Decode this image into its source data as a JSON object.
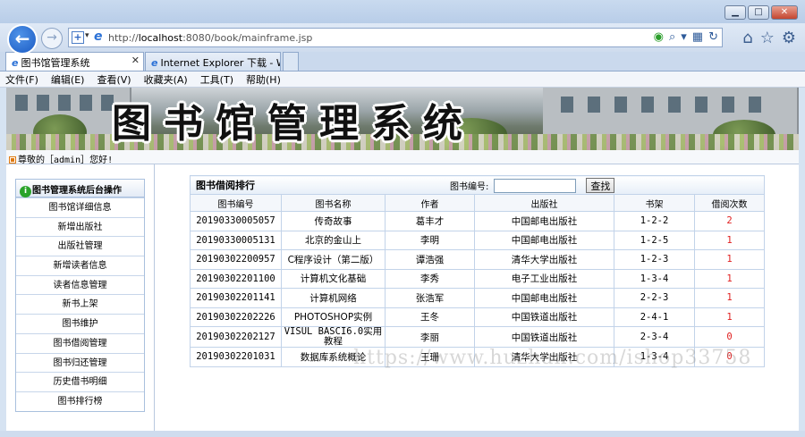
{
  "browser": {
    "url_prefix": "http://",
    "url_host": "localhost",
    "url_rest": ":8080/book/mainframe.jsp",
    "tabs": [
      {
        "label": "图书馆管理系统",
        "active": true
      },
      {
        "label": "Internet Explorer 下载 - W...",
        "active": false
      }
    ],
    "menu": [
      "文件(F)",
      "编辑(E)",
      "查看(V)",
      "收藏夹(A)",
      "工具(T)",
      "帮助(H)"
    ],
    "window_buttons": {
      "minimize": "▁",
      "maximize": "□",
      "close": "✕"
    }
  },
  "banner": {
    "title": "图书馆管理系统"
  },
  "welcome": {
    "text": "尊敬的［admin］您好!"
  },
  "sidebar": {
    "title": "图书管理系统后台操作",
    "items": [
      {
        "label": "图书馆详细信息"
      },
      {
        "label": "新增出版社"
      },
      {
        "label": "出版社管理"
      },
      {
        "label": "新增读者信息"
      },
      {
        "label": "读者信息管理"
      },
      {
        "label": "新书上架"
      },
      {
        "label": "图书维护"
      },
      {
        "label": "图书借阅管理"
      },
      {
        "label": "图书归还管理"
      },
      {
        "label": "历史借书明细"
      },
      {
        "label": "图书排行榜"
      }
    ]
  },
  "ranking": {
    "title": "图书借阅排行",
    "search_label": "图书编号:",
    "search_value": "",
    "search_button": "查找",
    "columns": [
      "图书编号",
      "图书名称",
      "作者",
      "出版社",
      "书架",
      "借阅次数"
    ],
    "rows": [
      {
        "id": "20190330005057",
        "name": "传奇故事",
        "author": "葛丰才",
        "publisher": "中国邮电出版社",
        "shelf": "1-2-2",
        "count": "2"
      },
      {
        "id": "20190330005131",
        "name": "北京的金山上",
        "author": "李明",
        "publisher": "中国邮电出版社",
        "shelf": "1-2-5",
        "count": "1"
      },
      {
        "id": "20190302200957",
        "name": "C程序设计（第二版）",
        "author": "谭浩强",
        "publisher": "清华大学出版社",
        "shelf": "1-2-3",
        "count": "1"
      },
      {
        "id": "20190302201100",
        "name": "计算机文化基础",
        "author": "李秀",
        "publisher": "电子工业出版社",
        "shelf": "1-3-4",
        "count": "1"
      },
      {
        "id": "20190302201141",
        "name": "计算机网络",
        "author": "张浩军",
        "publisher": "中国邮电出版社",
        "shelf": "2-2-3",
        "count": "1"
      },
      {
        "id": "20190302202226",
        "name": "PHOTOSHOP实例",
        "author": "王冬",
        "publisher": "中国铁道出版社",
        "shelf": "2-4-1",
        "count": "1"
      },
      {
        "id": "20190302202127",
        "name": "VISUL BASCI6.0实用教程",
        "author": "李丽",
        "publisher": "中国铁道出版社",
        "shelf": "2-3-4",
        "count": "0"
      },
      {
        "id": "20190302201031",
        "name": "数据库系统概论",
        "author": "王珊",
        "publisher": "清华大学出版社",
        "shelf": "1-3-4",
        "count": "0"
      }
    ]
  },
  "watermark": "https://www.huzhan.com/ishop33758"
}
